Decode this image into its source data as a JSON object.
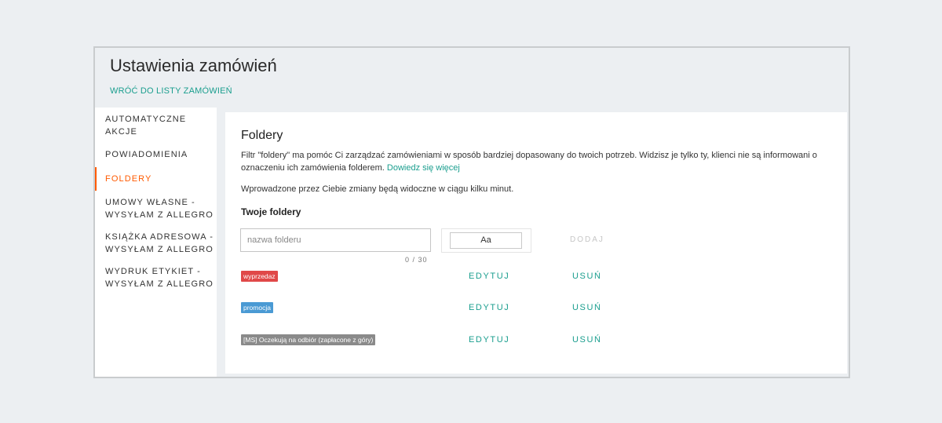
{
  "header": {
    "title": "Ustawienia zamówień",
    "back_link": "WRÓĆ DO LISTY ZAMÓWIEŃ"
  },
  "sidebar": {
    "items": [
      {
        "label_line1": "AUTOMATYCZNE",
        "label_line2": "AKCJE",
        "active": false
      },
      {
        "label_line1": "POWIADOMIENIA",
        "label_line2": "",
        "active": false
      },
      {
        "label_line1": "FOLDERY",
        "label_line2": "",
        "active": true
      },
      {
        "label_line1": "UMOWY WŁASNE -",
        "label_line2": "WYSYŁAM Z ALLEGRO",
        "active": false
      },
      {
        "label_line1": "KSIĄŻKA ADRESOWA -",
        "label_line2": "WYSYŁAM Z ALLEGRO",
        "active": false
      },
      {
        "label_line1": "WYDRUK ETYKIET -",
        "label_line2": "WYSYŁAM Z ALLEGRO",
        "active": false
      }
    ],
    "active_color": "#ff5a00"
  },
  "main": {
    "heading": "Foldery",
    "description": "Filtr \"foldery\" ma pomóc Ci zarządzać zamówieniami w sposób bardziej dopasowany do twoich potrzeb. Widzisz je tylko ty, klienci nie są informowani o oznaczeniu ich zamówienia folderem.",
    "learn_more": "Dowiedz się więcej",
    "notice": "Wprowadzone przez Ciebie zmiany będą widoczne w ciągu kilku minut.",
    "your_folders": "Twoje foldery",
    "input": {
      "placeholder": "nazwa folderu",
      "value": "",
      "counter": "0 / 30"
    },
    "color_button": "Aa",
    "add_button": "DODAJ",
    "folders": [
      {
        "name": "wyprzedaz",
        "color": "#e04848"
      },
      {
        "name": "promocja",
        "color": "#4a9ad4"
      },
      {
        "name": "[MS] Oczekują na odbiór (zapłacone z góry)",
        "color": "#8a8a8a"
      }
    ],
    "edit_label": "EDYTUJ",
    "delete_label": "USUŃ",
    "accent_color": "#1a9e8e"
  }
}
